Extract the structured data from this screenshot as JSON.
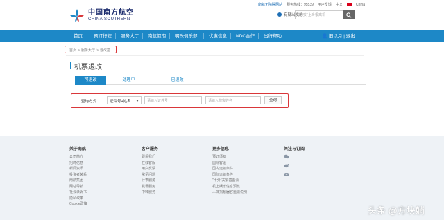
{
  "header": {
    "logo_cn": "中国南方航空",
    "logo_en": "CHINA SOUTHERN",
    "top_links": {
      "weibo": "南航无障碍网站",
      "hotline": "服务热线：95539",
      "feedback": "用户反馈",
      "language": "中文",
      "country": "China"
    },
    "location": "有疑出发地",
    "search_placeholder": "如何好上乡很离机"
  },
  "nav": {
    "items": [
      {
        "label": "首页"
      },
      {
        "label": "预订行程"
      },
      {
        "label": "服务大厅"
      },
      {
        "label": "南航假期"
      },
      {
        "label": "明珠俱乐部"
      },
      {
        "label": "优惠信息"
      },
      {
        "label": "NDC合作"
      },
      {
        "label": "出行帮助"
      }
    ],
    "login": "旧以月 | 退出"
  },
  "breadcrumb": {
    "home": "首页",
    "service": "服务大厅",
    "current": "退改签"
  },
  "page_title": "机票退改",
  "tabs": [
    {
      "label": "可退改"
    },
    {
      "label": "处理中"
    },
    {
      "label": "已退改"
    }
  ],
  "query": {
    "label": "查询方式：",
    "select_value": "证件号+姓名",
    "id_placeholder": "请输入证件号",
    "name_placeholder": "请输入旅客姓名",
    "button": "查询"
  },
  "footer": {
    "about": {
      "title": "关于南航",
      "items": [
        "公司简介",
        "招聘信息",
        "新闻资讯",
        "投资者关系",
        "南航集团",
        "网站导航",
        "社会录诉书",
        "隐私政策",
        "Cookie政策"
      ]
    },
    "service": {
      "title": "客户服务",
      "items": [
        "联系我们",
        "在线客服",
        "用户反馈",
        "常见问题",
        "行李服务",
        "机场服务",
        "中转服务"
      ]
    },
    "more": {
      "title": "更多信息",
      "items": [
        "预订须知",
        "国际客运",
        "国内运输条件",
        "国际运输条件",
        "\"十分\"关爱基金会",
        "机上娱乐信息预览",
        "人体捐献器官运输说明"
      ]
    },
    "follow": {
      "title": "关注与订阅"
    }
  },
  "watermark": "头条 @方块躺",
  "colors": {
    "nav_blue": "#1d88c7",
    "highlight_red": "#d9373a",
    "footer_bg": "#eef2f6"
  }
}
